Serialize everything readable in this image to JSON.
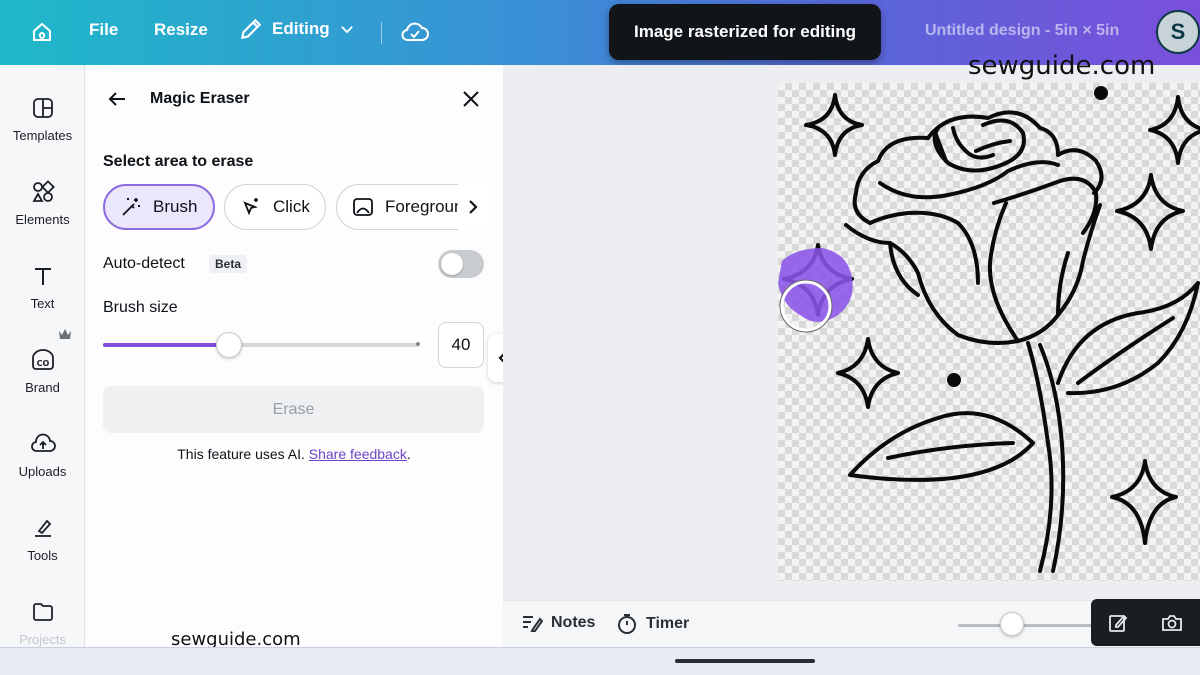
{
  "topbar": {
    "file_label": "File",
    "resize_label": "Resize",
    "editing_label": "Editing",
    "design_title": "Untitled design - 5in × 5in",
    "avatar_initial": "S"
  },
  "toast": {
    "message": "Image rasterized for editing"
  },
  "sidebar": {
    "items": [
      {
        "label": "Templates",
        "icon": "templates-icon"
      },
      {
        "label": "Elements",
        "icon": "elements-icon"
      },
      {
        "label": "Text",
        "icon": "text-icon"
      },
      {
        "label": "Brand",
        "icon": "brand-icon"
      },
      {
        "label": "Uploads",
        "icon": "uploads-icon"
      },
      {
        "label": "Tools",
        "icon": "tools-icon"
      },
      {
        "label": "Projects",
        "icon": "projects-icon"
      }
    ]
  },
  "panel": {
    "title": "Magic Eraser",
    "section_title": "Select area to erase",
    "modes": [
      {
        "label": "Brush",
        "active": true
      },
      {
        "label": "Click",
        "active": false
      },
      {
        "label": "Foregroun",
        "active": false
      }
    ],
    "auto_detect_label": "Auto-detect",
    "beta_badge": "Beta",
    "auto_detect_on": false,
    "brush_size_label": "Brush size",
    "brush_size_value": "40",
    "brush_size_fraction": 0.4,
    "erase_label": "Erase",
    "ai_note_prefix": "This feature uses AI. ",
    "ai_note_link": "Share feedback",
    "ai_note_suffix": "."
  },
  "canvas": {
    "watermark": "sewguide.com",
    "brush_color": "#8a55e8"
  },
  "bottombar": {
    "notes_label": "Notes",
    "timer_label": "Timer"
  },
  "footer_watermark": "sewguide.com",
  "colors": {
    "accent": "#7d4fdc",
    "topbar_gradient_start": "#1fb8c9",
    "topbar_gradient_end": "#7a4fd9"
  }
}
